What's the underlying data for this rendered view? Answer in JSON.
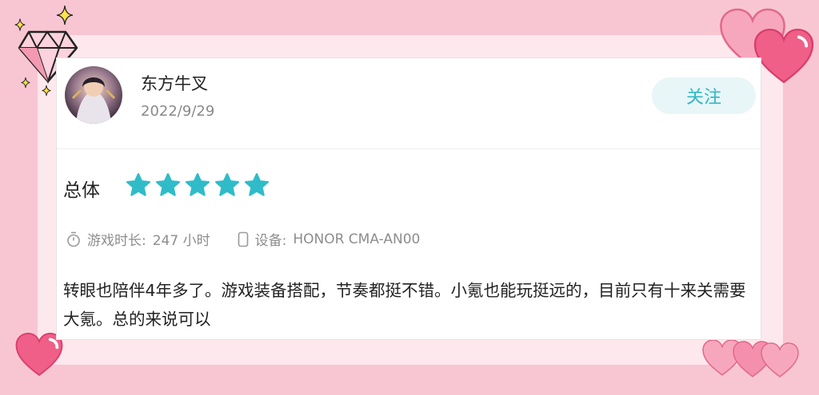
{
  "user": {
    "name": "东方牛叉",
    "date": "2022/9/29"
  },
  "follow_label": "关注",
  "rating": {
    "label": "总体",
    "stars": 5,
    "max": 5,
    "star_color": "#2fbcc8"
  },
  "meta": {
    "playtime_label": "游戏时长:",
    "playtime_value": "247 小时",
    "device_label": "设备:",
    "device_value": "HONOR CMA-AN00"
  },
  "review_text": "转眼也陪伴4年多了。游戏装备搭配，节奏都挺不错。小氪也能玩挺远的，目前只有十来关需要大氪。总的来说可以",
  "colors": {
    "background": "#f8c6d2",
    "accent": "#2fb7c4",
    "follow_bg": "#e8f6f8"
  },
  "icons": [
    "diamond-icon",
    "sparkle-icon",
    "heart-icon",
    "clock-icon",
    "phone-icon",
    "star-icon"
  ]
}
